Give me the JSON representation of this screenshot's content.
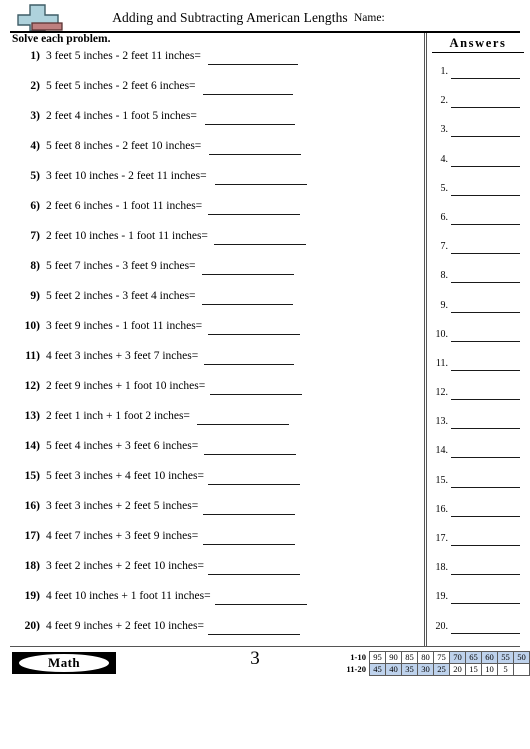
{
  "header": {
    "title": "Adding and Subtracting American Lengths",
    "name_label": "Name:",
    "logo_icon": "plus-minus-icon"
  },
  "instruction": "Solve each problem.",
  "problems": [
    {
      "number": "1)",
      "text": "3 feet 5 inches - 2 feet 11 inches="
    },
    {
      "number": "2)",
      "text": "5 feet 5 inches - 2 feet 6 inches="
    },
    {
      "number": "3)",
      "text": "2 feet 4 inches - 1 foot 5 inches="
    },
    {
      "number": "4)",
      "text": "5 feet 8 inches - 2 feet 10 inches="
    },
    {
      "number": "5)",
      "text": "3 feet 10 inches - 2 feet 11 inches="
    },
    {
      "number": "6)",
      "text": "2 feet 6 inches - 1 foot 11 inches="
    },
    {
      "number": "7)",
      "text": "2 feet 10 inches - 1 foot 11 inches="
    },
    {
      "number": "8)",
      "text": "5 feet 7 inches - 3 feet 9 inches="
    },
    {
      "number": "9)",
      "text": "5 feet 2 inches - 3 feet 4 inches="
    },
    {
      "number": "10)",
      "text": "3 feet 9 inches - 1 foot 11 inches="
    },
    {
      "number": "11)",
      "text": "4 feet 3 inches + 3 feet 7 inches="
    },
    {
      "number": "12)",
      "text": "2 feet 9 inches + 1 foot 10 inches="
    },
    {
      "number": "13)",
      "text": "2 feet 1 inch + 1 foot 2 inches="
    },
    {
      "number": "14)",
      "text": "5 feet 4 inches + 3 feet 6 inches="
    },
    {
      "number": "15)",
      "text": "5 feet 3 inches + 4 feet 10 inches="
    },
    {
      "number": "16)",
      "text": "3 feet 3 inches + 2 feet 5 inches="
    },
    {
      "number": "17)",
      "text": "4 feet 7 inches + 3 feet 9 inches="
    },
    {
      "number": "18)",
      "text": "3 feet 2 inches + 2 feet 10 inches="
    },
    {
      "number": "19)",
      "text": "4 feet 10 inches + 1 foot 11 inches="
    },
    {
      "number": "20)",
      "text": "4 feet 9 inches + 2 feet 10 inches="
    }
  ],
  "answers": {
    "title": "Answers",
    "rows": [
      {
        "label": "1."
      },
      {
        "label": "2."
      },
      {
        "label": "3."
      },
      {
        "label": "4."
      },
      {
        "label": "5."
      },
      {
        "label": "6."
      },
      {
        "label": "7."
      },
      {
        "label": "8."
      },
      {
        "label": "9."
      },
      {
        "label": "10."
      },
      {
        "label": "11."
      },
      {
        "label": "12."
      },
      {
        "label": "13."
      },
      {
        "label": "14."
      },
      {
        "label": "15."
      },
      {
        "label": "16."
      },
      {
        "label": "17."
      },
      {
        "label": "18."
      },
      {
        "label": "19."
      },
      {
        "label": "20."
      }
    ]
  },
  "footer": {
    "subject_badge": "Math",
    "page_number": "3",
    "score_table": {
      "highlight_color": "#bed2ec",
      "rows": [
        {
          "label": "1-10",
          "cells": [
            {
              "value": "95",
              "highlighted": false
            },
            {
              "value": "90",
              "highlighted": false
            },
            {
              "value": "85",
              "highlighted": false
            },
            {
              "value": "80",
              "highlighted": false
            },
            {
              "value": "75",
              "highlighted": false
            },
            {
              "value": "70",
              "highlighted": true
            },
            {
              "value": "65",
              "highlighted": true
            },
            {
              "value": "60",
              "highlighted": true
            },
            {
              "value": "55",
              "highlighted": true
            },
            {
              "value": "50",
              "highlighted": true
            }
          ]
        },
        {
          "label": "11-20",
          "cells": [
            {
              "value": "45",
              "highlighted": true
            },
            {
              "value": "40",
              "highlighted": true
            },
            {
              "value": "35",
              "highlighted": true
            },
            {
              "value": "30",
              "highlighted": true
            },
            {
              "value": "25",
              "highlighted": true
            },
            {
              "value": "20",
              "highlighted": false
            },
            {
              "value": "15",
              "highlighted": false
            },
            {
              "value": "10",
              "highlighted": false
            },
            {
              "value": "5",
              "highlighted": false
            },
            {
              "value": "",
              "highlighted": false
            }
          ]
        }
      ]
    }
  }
}
